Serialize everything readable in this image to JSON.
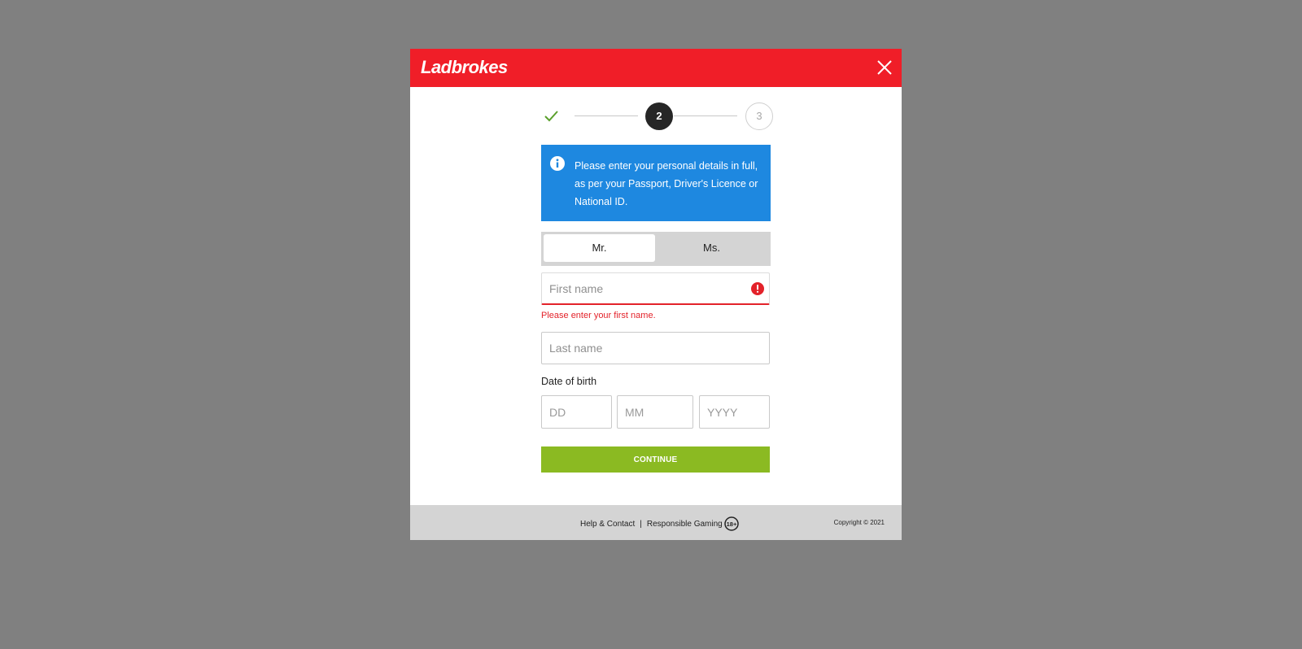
{
  "header": {
    "brand": "Ladbrokes",
    "colors": {
      "header_bg": "#f01e28"
    }
  },
  "stepper": {
    "steps": [
      {
        "label": "",
        "state": "complete",
        "icon": "check-icon"
      },
      {
        "label": "2",
        "state": "active"
      },
      {
        "label": "3",
        "state": "pending"
      }
    ]
  },
  "info": {
    "icon": "info-icon",
    "text": "Please enter your personal details in full, as per your Passport, Driver's Licence or National ID."
  },
  "title_toggle": {
    "options": [
      {
        "label": "Mr.",
        "selected": true
      },
      {
        "label": "Ms.",
        "selected": false
      }
    ]
  },
  "form": {
    "first_name": {
      "placeholder": "First name",
      "value": "",
      "error": "Please enter your first name."
    },
    "last_name": {
      "placeholder": "Last name",
      "value": ""
    },
    "dob": {
      "label": "Date of birth",
      "day_placeholder": "DD",
      "month_placeholder": "MM",
      "year_placeholder": "YYYY"
    },
    "continue_label": "CONTINUE"
  },
  "footer": {
    "help_label": "Help & Contact",
    "separator": "|",
    "responsible_label": "Responsible Gaming",
    "age_label": "18+",
    "copyright": "Copyright © 2021"
  },
  "colors": {
    "info_bg": "#1e88e0",
    "error": "#e3222a",
    "continue_bg": "#8bba22",
    "check": "#5aa02c"
  }
}
